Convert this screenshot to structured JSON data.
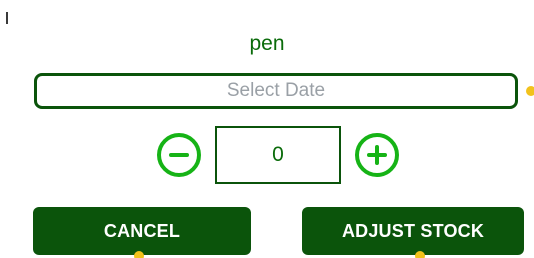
{
  "dialog": {
    "title": "pen",
    "date_placeholder": "Select Date",
    "quantity": "0",
    "cancel_label": "CANCEL",
    "adjust_label": "ADJUST STOCK"
  },
  "icons": {
    "decrement": "minus-circle-icon",
    "increment": "plus-circle-icon"
  },
  "colors": {
    "primary_dark": "#0b540b",
    "title_green": "#0a6b0a",
    "stepper_green": "#16b316",
    "placeholder_gray": "#9aa0a6",
    "accent_yellow": "#f2c21c"
  }
}
